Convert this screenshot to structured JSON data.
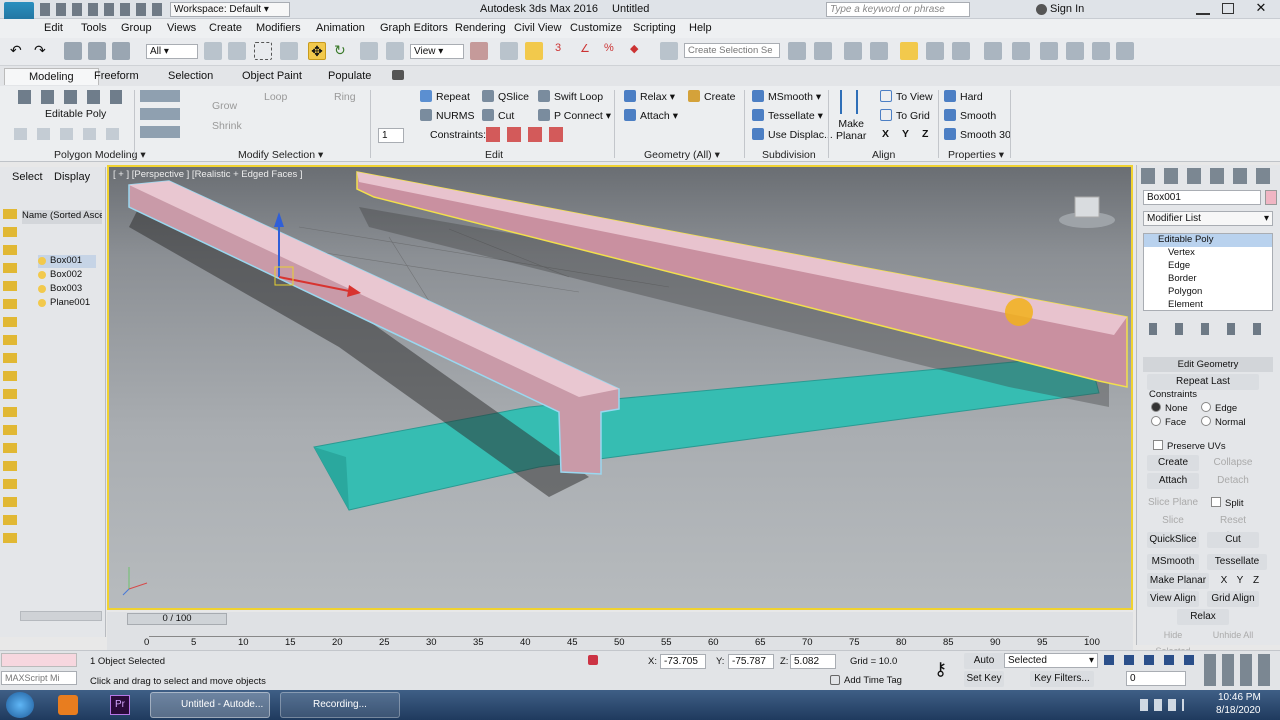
{
  "titlebar": {
    "workspace": "Workspace: Default",
    "app_title": "Autodesk 3ds Max 2016",
    "doc_title": "Untitled",
    "search_placeholder": "Type a keyword or phrase",
    "sign_in": "Sign In"
  },
  "menu": [
    "Edit",
    "Tools",
    "Group",
    "Views",
    "Create",
    "Modifiers",
    "Animation",
    "Graph Editors",
    "Rendering",
    "Civil View",
    "Customize",
    "Scripting",
    "Help"
  ],
  "toolbar": {
    "filter": "All",
    "ref_coord": "View",
    "selection_set_placeholder": "Create Selection Se"
  },
  "ribbon_tabs": [
    "Modeling",
    "Freeform",
    "Selection",
    "Object Paint",
    "Populate"
  ],
  "ribbon": {
    "editable_poly": "Editable Poly",
    "grow": "Grow",
    "shrink": "Shrink",
    "loop": "Loop",
    "ring": "Ring",
    "spinner_value": "1",
    "repeat": "Repeat",
    "qslice": "QSlice",
    "swift_loop": "Swift Loop",
    "nurms": "NURMS",
    "cut": "Cut",
    "p_connect": "P Connect",
    "constraints": "Constraints:",
    "relax": "Relax",
    "create": "Create",
    "attach": "Attach",
    "msmooth": "MSmooth",
    "tessellate": "Tessellate",
    "use_displac": "Use Displac...",
    "make_planar_1": "Make",
    "make_planar_2": "Planar",
    "to_view": "To View",
    "to_grid": "To Grid",
    "x": "X",
    "y": "Y",
    "z": "Z",
    "hard": "Hard",
    "smooth": "Smooth",
    "smooth30": "Smooth 30",
    "groups": [
      "Polygon Modeling",
      "Modify Selection",
      "Edit",
      "Geometry (All)",
      "Subdivision",
      "Align",
      "Properties"
    ]
  },
  "scene_explorer": {
    "tab_select": "Select",
    "tab_display": "Display",
    "header": "Name (Sorted Ascen",
    "items": [
      "Box001",
      "Box002",
      "Box003",
      "Plane001"
    ]
  },
  "viewport": {
    "label": "[ + ] [Perspective ] [Realistic + Edged Faces ]"
  },
  "command_panel": {
    "object_name": "Box001",
    "modifier_list": "Modifier List",
    "stack": [
      "Editable Poly",
      "Vertex",
      "Edge",
      "Border",
      "Polygon",
      "Element"
    ],
    "rollout_title": "Edit Geometry",
    "repeat_last": "Repeat Last",
    "constraints": "Constraints",
    "none": "None",
    "edge": "Edge",
    "face": "Face",
    "normal": "Normal",
    "preserve_uvs": "Preserve UVs",
    "create": "Create",
    "collapse": "Collapse",
    "attach": "Attach",
    "detach": "Detach",
    "slice_plane": "Slice Plane",
    "split": "Split",
    "slice": "Slice",
    "reset_plane": "Reset Plane",
    "quickslice": "QuickSlice",
    "cut": "Cut",
    "msmooth": "MSmooth",
    "tessellate": "Tessellate",
    "make_planar": "Make Planar",
    "x": "X",
    "y": "Y",
    "z": "Z",
    "view_align": "View Align",
    "grid_align": "Grid Align",
    "relax": "Relax",
    "hide_selected": "Hide Selected",
    "unhide_all": "Unhide All"
  },
  "timeline": {
    "frame": "0 / 100",
    "ticks": [
      "0",
      "5",
      "10",
      "15",
      "20",
      "25",
      "30",
      "35",
      "40",
      "45",
      "50",
      "55",
      "60",
      "65",
      "70",
      "75",
      "80",
      "85",
      "90",
      "95",
      "100"
    ]
  },
  "status": {
    "maxscript": "MAXScript Mi",
    "selected": "1 Object Selected",
    "prompt": "Click and drag to select and move objects",
    "x_label": "X:",
    "x": "-73.705",
    "y_label": "Y:",
    "y": "-75.787",
    "z_label": "Z:",
    "z": "5.082",
    "grid": "Grid = 10.0",
    "add_time_tag": "Add Time Tag",
    "auto_key": "Auto Key",
    "selected_dd": "Selected",
    "set_key": "Set Key",
    "key_filters": "Key Filters...",
    "frame_field": "0"
  },
  "taskbar": {
    "item1": "Untitled - Autode...",
    "item2": "Recording...",
    "time": "10:46 PM",
    "date": "8/18/2020"
  }
}
